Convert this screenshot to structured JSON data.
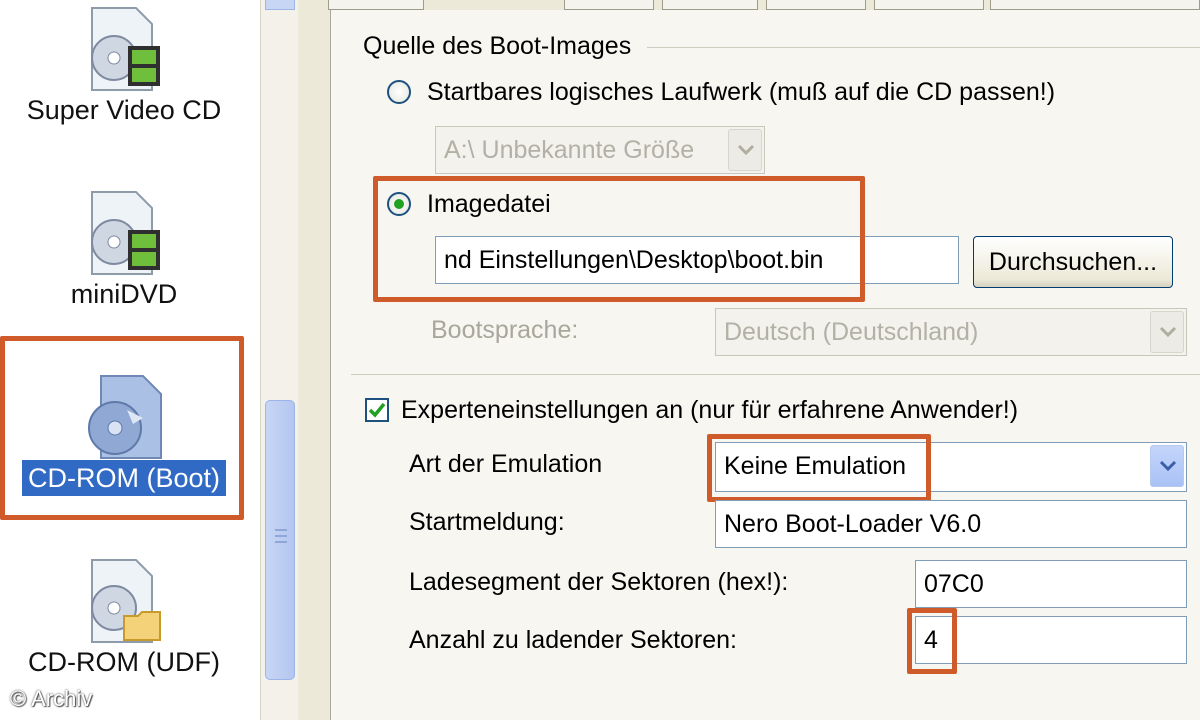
{
  "sidebar": {
    "items": [
      {
        "label": "Super Video CD"
      },
      {
        "label": "miniDVD"
      },
      {
        "label": "CD-ROM (Boot)"
      },
      {
        "label": "CD-ROM (UDF)"
      }
    ]
  },
  "boot_source": {
    "group_title": "Quelle des Boot-Images",
    "drive_option_label": "Startbares logisches Laufwerk (muß auf die CD passen!)",
    "drive_select_value": "A:\\  Unbekannte Größe",
    "image_option_label": "Imagedatei",
    "image_path_value": "nd Einstellungen\\Desktop\\boot.bin",
    "browse_button_label": "Durchsuchen...",
    "boot_language_label": "Bootsprache:",
    "boot_language_value": "Deutsch (Deutschland)"
  },
  "expert": {
    "checkbox_label": "Experteneinstellungen an (nur für erfahrene Anwender!)",
    "emulation_label": "Art der Emulation",
    "emulation_value": "Keine Emulation",
    "start_message_label": "Startmeldung:",
    "start_message_value": "Nero Boot-Loader V6.0",
    "load_segment_label": "Ladesegment der Sektoren (hex!):",
    "load_segment_value": "07C0",
    "sector_count_label": "Anzahl zu ladender Sektoren:",
    "sector_count_value": "4"
  },
  "copyright": "© Archiv",
  "colors": {
    "highlight": "#cf5b2a",
    "selection": "#316ac5"
  }
}
